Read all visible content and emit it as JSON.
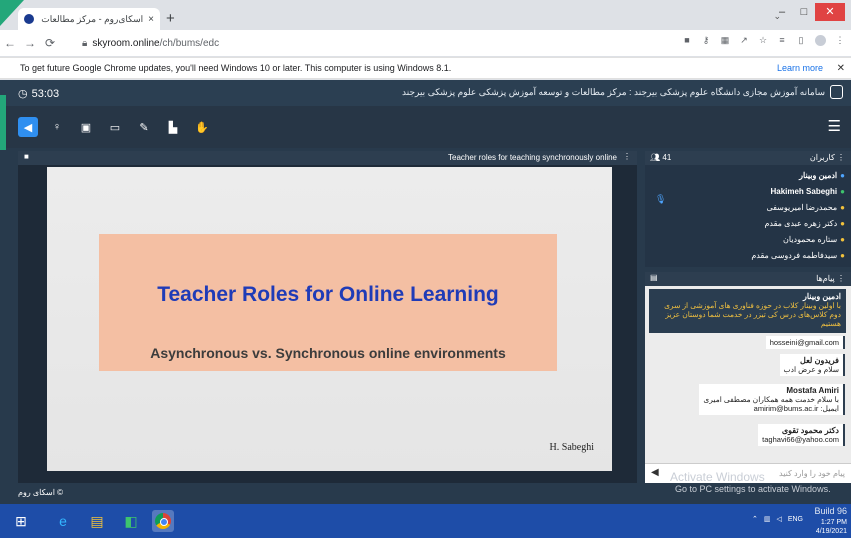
{
  "browser": {
    "tab_title": "اسکای‌روم - مرکز مطالعات و ...",
    "tab_close": "×",
    "new_tab": "+",
    "url_host": "skyroom.online",
    "url_path": "/ch/bums/edc",
    "window": {
      "minimize": "–",
      "maximize": "□",
      "close": "✕",
      "tab_search": "⌄"
    }
  },
  "infobar": {
    "message": "To get future Google Chrome updates, you'll need Windows 10 or later. This computer is using Windows 8.1.",
    "learn_more": "Learn more",
    "close": "✕"
  },
  "app": {
    "timer": "53:03",
    "title": "سامانه آموزش مجازی دانشگاه علوم پزشکی بیرجند : مرکز مطالعات و توسعه آموزش پزشکی علوم پزشکی بیرجند",
    "stage_title": "Teacher roles for teaching synchronously online",
    "footer": "اسکای روم ©",
    "slide": {
      "title": "Teacher Roles for Online Learning",
      "subtitle": "Asynchronous vs. Synchronous online environments",
      "author": "H. Sabeghi"
    },
    "users": {
      "count": "41",
      "label": "کاربران",
      "list": [
        {
          "name": "ادمین وبینار",
          "bold": true
        },
        {
          "name": "Hakimeh Sabeghi",
          "bold": false
        },
        {
          "name": "محمدرضا امیریوسفی",
          "bold": false
        },
        {
          "name": "دکتر زهره عبدی مقدم",
          "bold": false
        },
        {
          "name": "ستاره محمودیان",
          "bold": false
        },
        {
          "name": "سیدفاطمه فردوسی مقدم",
          "bold": false
        }
      ]
    },
    "chat": {
      "label": "پیام‌ها",
      "pinned_name": "ادمین وبینار",
      "pinned_msg": "با اولین وبینار کلاب در حوزه فناوری های آموزشی از سری دوم کلاس‌های درس کی تیزر در خدمت شما دوستان عزیز هستیم",
      "messages": [
        {
          "name": "",
          "text": "hosseini@gmail.com"
        },
        {
          "name": "فریدون لعل",
          "text": "سلام و عرض ادب"
        },
        {
          "name": "Mostafa Amiri",
          "text": "با سلام خدمت همه همکاران مصطفی امیری",
          "text2": "amirim@bums.ac.ir :ایمیل"
        },
        {
          "name": "دکتر محمود تقوی",
          "text": "taghavi66@yahoo.com"
        }
      ],
      "input_placeholder": "پیام خود را وارد کنید"
    },
    "activate": {
      "line1": "Activate Windows",
      "line2": "Go to PC settings to activate Windows."
    }
  },
  "taskbar": {
    "lang": "ENG",
    "time": "1:27 PM",
    "date": "4/19/2021",
    "build": "Build 96"
  }
}
